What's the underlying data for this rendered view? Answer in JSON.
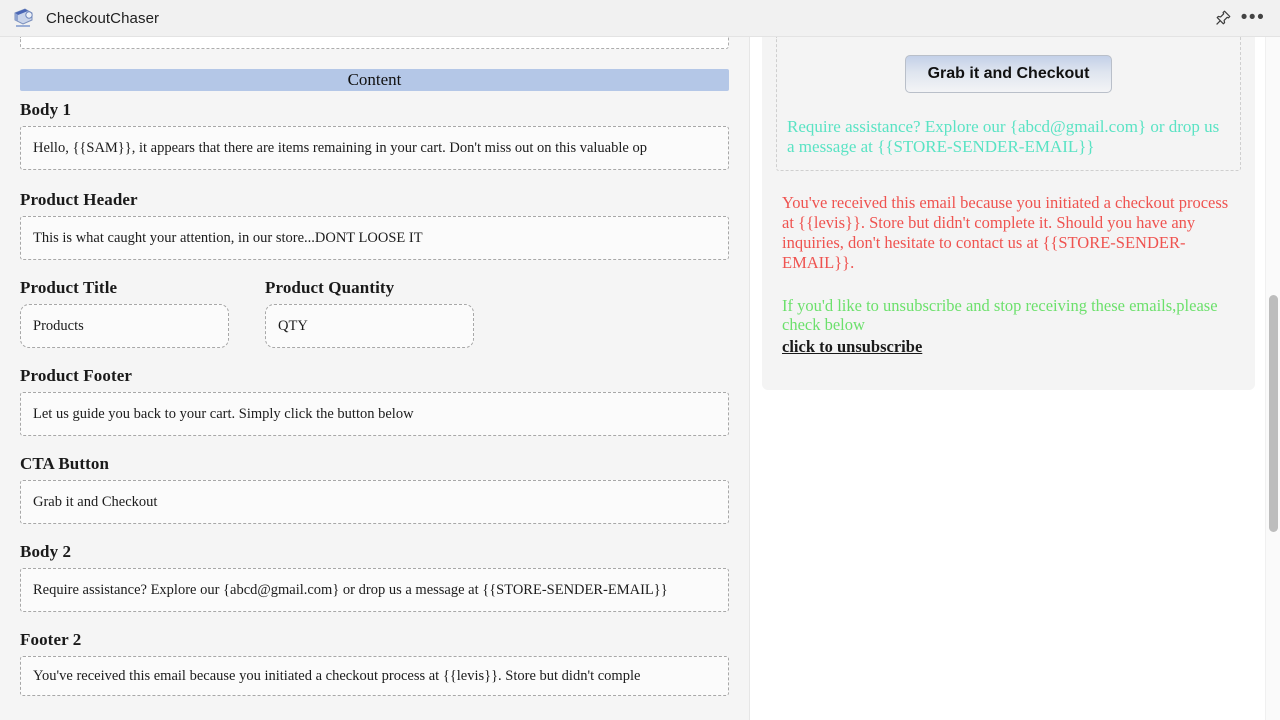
{
  "titlebar": {
    "app_name": "CheckoutChaser",
    "logo_icon": "checkout-chaser-logo-icon",
    "pin_icon": "pin-icon",
    "more_icon": "more-options-icon",
    "more_label": "•••"
  },
  "editor": {
    "section_title": "Content",
    "fields": [
      {
        "label": "Body 1",
        "value": "Hello, {{SAM}}, it appears that there are items remaining in your cart. Don't miss out on this valuable op"
      },
      {
        "label": "Product Header",
        "value": "This is what caught your attention, in our store...DONT LOOSE IT"
      },
      {
        "label": "Product Title",
        "value": "Products"
      },
      {
        "label": "Product Quantity",
        "value": "QTY"
      },
      {
        "label": "Product Footer",
        "value": "Let us guide you back to your cart. Simply click the button below"
      },
      {
        "label": "CTA Button",
        "value": "Grab it and Checkout"
      },
      {
        "label": "Body 2",
        "value": "Require assistance? Explore our {abcd@gmail.com} or drop us a message at {{STORE-SENDER-EMAIL}}"
      },
      {
        "label": "Footer 2",
        "value": "You've received this email because you initiated a checkout process at {{levis}}. Store but didn't comple"
      }
    ]
  },
  "preview": {
    "cta_button_label": "Grab it and Checkout",
    "body2_text": "Require assistance? Explore our {abcd@gmail.com} or drop us a message at {{STORE-SENDER-EMAIL}}",
    "footer2_text": "You've received this email because you initiated a checkout process at {{levis}}. Store but didn't complete it. Should you have any inquiries, don't hesitate to contact us at {{STORE-SENDER-EMAIL}}.",
    "unsubscribe_text": "If you'd like to unsubscribe and stop receiving these emails,please check below",
    "unsubscribe_link": "click to unsubscribe"
  },
  "colors": {
    "section_bar": "#b4c7e7",
    "preview_teal": "#5ae3c4",
    "preview_red": "#ef5350",
    "preview_green": "#6ce06c",
    "editor_background": "#f5f5f5"
  }
}
